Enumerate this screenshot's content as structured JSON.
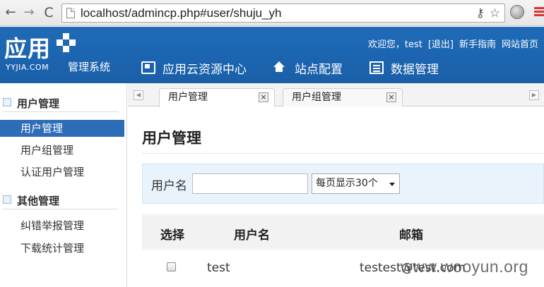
{
  "browser": {
    "url": "localhost/admincp.php#user/shuju_yh"
  },
  "header": {
    "logo_text": "应用",
    "logo_sub": "YYJIA.COM",
    "system_name": "管理系统",
    "welcome": "欢迎您，test",
    "logout": "[退出]",
    "guide": "新手指南",
    "site_home": "网站首页",
    "nav": [
      {
        "label": "应用云资源中心",
        "icon": "window-icon"
      },
      {
        "label": "站点配置",
        "icon": "home-icon"
      },
      {
        "label": "数据管理",
        "icon": "list-icon"
      }
    ]
  },
  "sidebar": {
    "groups": [
      {
        "label": "用户管理",
        "items": [
          "用户管理",
          "用户组管理",
          "认证用户管理"
        ]
      },
      {
        "label": "其他管理",
        "items": [
          "纠错举报管理",
          "下载统计管理"
        ]
      }
    ],
    "active_item": "用户管理"
  },
  "tabs": [
    {
      "label": "用户管理",
      "active": true
    },
    {
      "label": "用户组管理",
      "active": false
    }
  ],
  "main": {
    "title": "用户管理",
    "filter": {
      "username_label": "用户名",
      "username_value": "",
      "per_page": "每页显示30个"
    },
    "table": {
      "headers": [
        "选择",
        "用户名",
        "邮箱"
      ],
      "rows": [
        {
          "checked": false,
          "username": "test",
          "email": "testest@test.com"
        }
      ]
    }
  },
  "watermark": "www.wooyun.org",
  "colors": {
    "header_blue": "#1f6bb8",
    "active_item": "#2d6db8",
    "filter_bg": "#e9f3fb"
  }
}
